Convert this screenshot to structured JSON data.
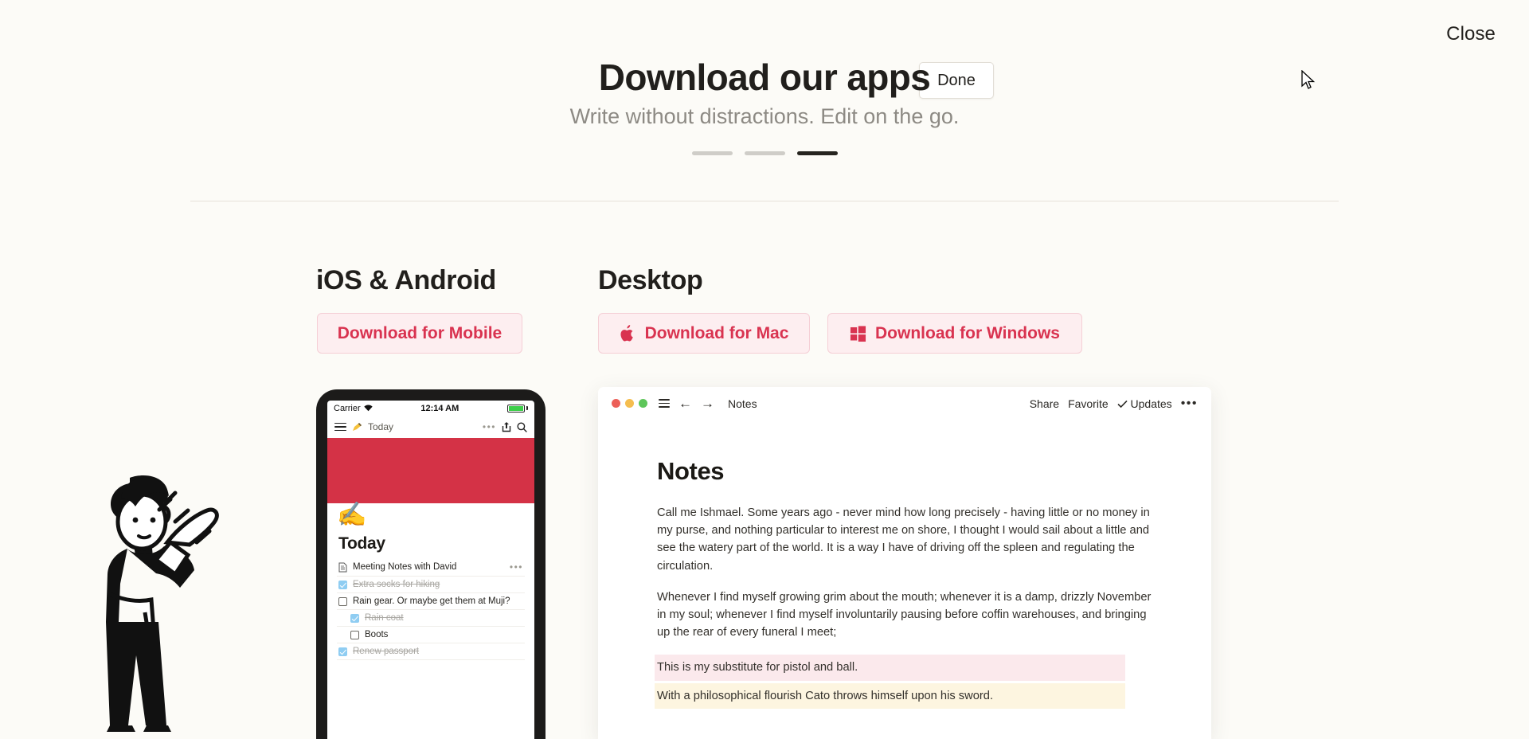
{
  "topbar": {
    "close_label": "Close",
    "done_label": "Done"
  },
  "header": {
    "title": "Download our apps",
    "subtitle": "Write without distractions. Edit on the go.",
    "pagination": {
      "total": 3,
      "active_index": 3
    }
  },
  "sections": {
    "mobile": {
      "heading": "iOS & Android",
      "button_label": "Download for Mobile"
    },
    "desktop": {
      "heading": "Desktop",
      "mac_button_label": "Download for Mac",
      "mac_icon": "apple-logo-icon",
      "windows_button_label": "Download for Windows",
      "windows_icon": "windows-logo-icon"
    }
  },
  "phone_mockup": {
    "status_bar": {
      "carrier": "Carrier",
      "wifi_icon": "wifi-icon",
      "time": "12:14 AM",
      "battery_icon": "battery-icon"
    },
    "toolbar": {
      "menu_icon": "hamburger-icon",
      "pencil_icon": "pencil-icon",
      "title": "Today",
      "more_icon": "more-icon",
      "share_icon": "share-icon",
      "search_icon": "search-icon"
    },
    "emoji": "✍️",
    "heading": "Today",
    "items": [
      {
        "label": "Meeting Notes with David",
        "type": "document",
        "done": false,
        "nested": false,
        "trailing": "•••"
      },
      {
        "label": "Extra socks for hiking",
        "type": "checkbox",
        "done": true,
        "nested": false,
        "trailing": ""
      },
      {
        "label": "Rain gear. Or maybe get them at Muji?",
        "type": "checkbox",
        "done": false,
        "nested": false,
        "trailing": ""
      },
      {
        "label": "Rain coat",
        "type": "checkbox",
        "done": true,
        "nested": true,
        "trailing": ""
      },
      {
        "label": "Boots",
        "type": "checkbox",
        "done": false,
        "nested": true,
        "trailing": ""
      },
      {
        "label": "Renew passport",
        "type": "checkbox",
        "done": true,
        "nested": false,
        "trailing": ""
      }
    ]
  },
  "desktop_mockup": {
    "window": {
      "traffic_lights": [
        "close",
        "minimize",
        "zoom"
      ],
      "menu_icon": "hamburger-icon",
      "back_icon": "arrow-left-icon",
      "forward_icon": "arrow-right-icon",
      "title": "Notes",
      "actions": [
        "Share",
        "Favorite"
      ],
      "updates_label": "Updates",
      "updates_check_icon": "check-icon",
      "more_icon": "more-icon"
    },
    "document": {
      "title": "Notes",
      "paragraphs": [
        "Call me Ishmael. Some years ago - never mind how long precisely - having little or no money in my purse, and nothing particular to interest me on shore, I thought I would sail about a little and see the watery part of the world. It is a way I have of driving off the spleen and regulating the circulation.",
        "Whenever I find myself growing grim about the mouth; whenever it is a damp, drizzly November in my soul; whenever I find myself involuntarily pausing before coffin warehouses, and bringing up the rear of every funeral I meet;"
      ],
      "highlights": [
        {
          "text": "This is my substitute for pistol and ball.",
          "color": "#fbe9ec"
        },
        {
          "text": "With a philosophical flourish Cato throws himself upon his sword.",
          "color": "#fdf5e0"
        }
      ]
    }
  },
  "illustration": {
    "alt": "person-waving-illustration"
  },
  "colors": {
    "page_background": "#fcfbf7",
    "accent": "#d93350",
    "accent_soft": "#fdeef0",
    "banner_red": "#d43246",
    "text_primary": "#211f1c",
    "text_muted": "#8d8a84"
  }
}
